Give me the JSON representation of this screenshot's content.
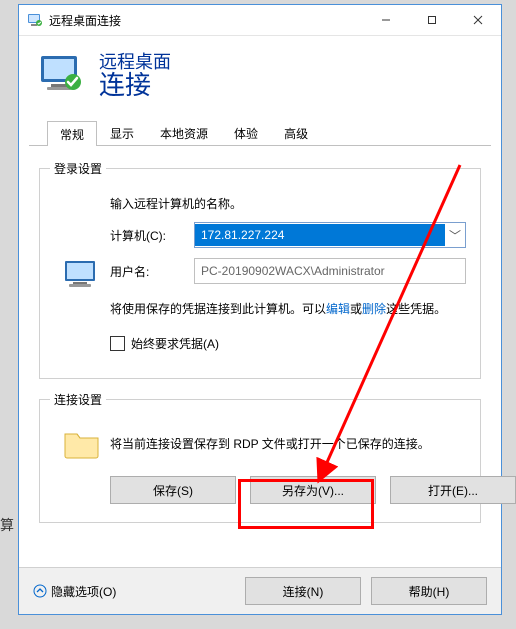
{
  "outside_text": "算",
  "window": {
    "title": "远程桌面连接"
  },
  "header": {
    "line1": "远程桌面",
    "line2": "连接"
  },
  "tabs": [
    "常规",
    "显示",
    "本地资源",
    "体验",
    "高级"
  ],
  "login_group": {
    "legend": "登录设置",
    "prompt": "输入远程计算机的名称。",
    "computer_label": "计算机(C):",
    "computer_value": "172.81.227.224",
    "user_label": "用户名:",
    "user_value": "PC-20190902WACX\\Administrator",
    "note_pre": "将使用保存的凭据连接到此计算机。可以",
    "note_link1": "编辑",
    "note_mid": "或",
    "note_link2": "删除",
    "note_post": "这些凭据。",
    "checkbox_label": "始终要求凭据(A)"
  },
  "conn_group": {
    "legend": "连接设置",
    "desc": "将当前连接设置保存到 RDP 文件或打开一个已保存的连接。",
    "save": "保存(S)",
    "saveas": "另存为(V)...",
    "open": "打开(E)..."
  },
  "footer": {
    "hide_options": "隐藏选项(O)",
    "connect": "连接(N)",
    "help": "帮助(H)"
  }
}
